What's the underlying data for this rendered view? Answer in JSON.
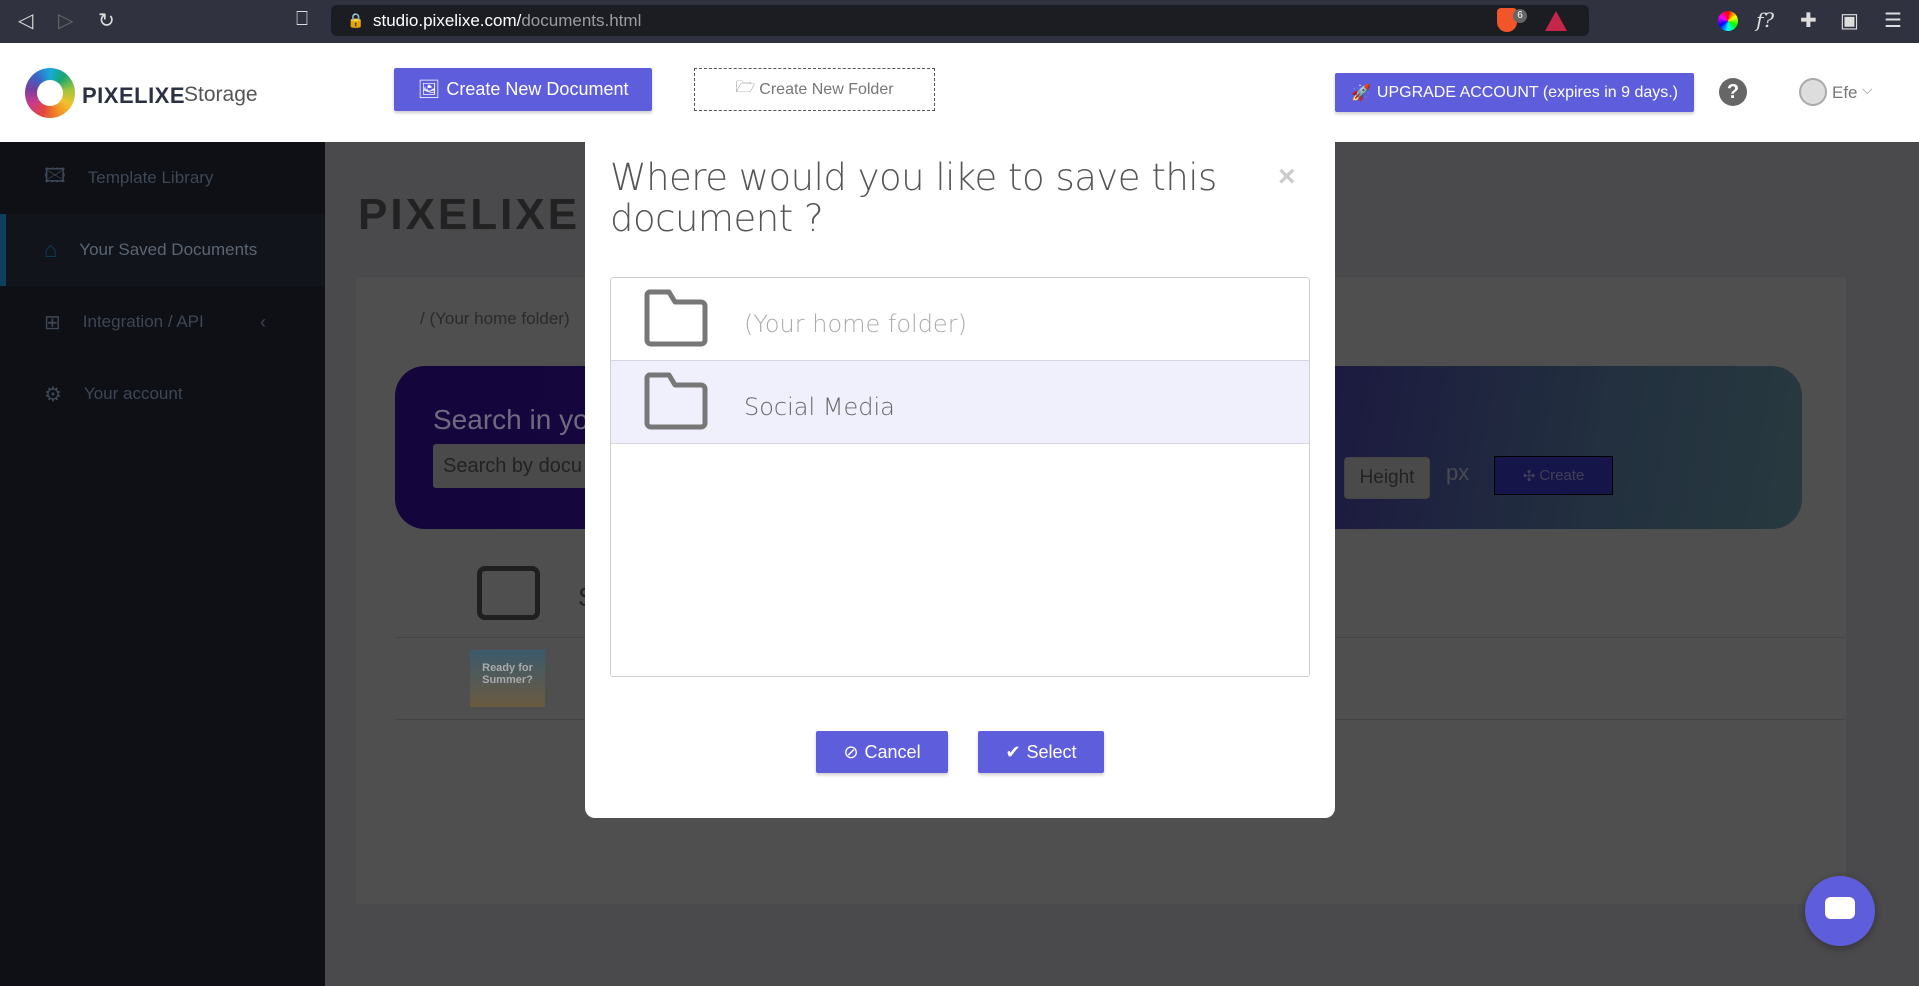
{
  "browser": {
    "url_host": "studio.pixelixe.com/",
    "url_path": "documents.html",
    "shield_count": "6"
  },
  "header": {
    "brand": "PIXELIXE",
    "brand_suffix": "Storage",
    "create_document": "Create New Document",
    "create_folder": "Create New Folder",
    "upgrade": "UPGRADE ACCOUNT (expires in 9 days.)",
    "user": "Efe",
    "accent": "#5e5edc"
  },
  "sidebar": {
    "items": [
      {
        "label": "Template Library",
        "icon": "images-icon"
      },
      {
        "label": "Your Saved Documents",
        "icon": "home-icon",
        "active": true
      },
      {
        "label": "Integration / API",
        "icon": "sitemap-icon"
      },
      {
        "label": "Your account",
        "icon": "gear-icon"
      }
    ]
  },
  "main": {
    "logo": "PIXELIXE",
    "breadcrumb": "/ (Your home folder)",
    "search_title": "Search in yo",
    "search_placeholder": "Search by docu",
    "height_placeholder": "Height",
    "px": "px",
    "create": "Create",
    "folder_initial": "S",
    "thumb_text": "Ready for Summer?"
  },
  "modal": {
    "title": "Where would you like to save this document ?",
    "close": "×",
    "folders": [
      {
        "label": "(Your home folder)",
        "selected": false
      },
      {
        "label": "Social Media",
        "selected": true
      }
    ],
    "cancel": "Cancel",
    "select": "Select"
  }
}
